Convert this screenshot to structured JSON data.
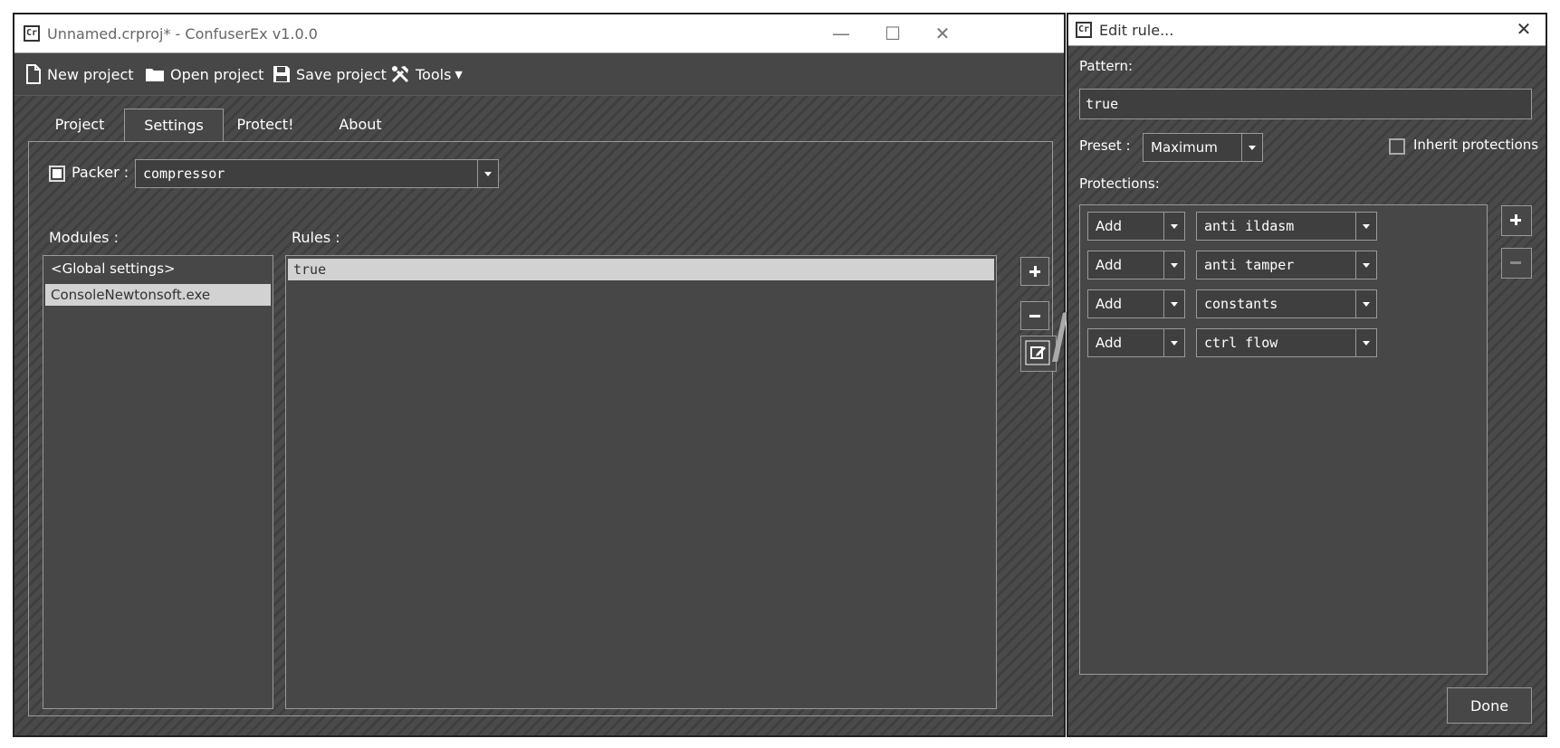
{
  "main_window": {
    "title": "Unnamed.crproj* - ConfuserEx v1.0.0",
    "app_icon": "Cr",
    "controls": {
      "minimize": "—",
      "maximize": "☐",
      "close": "✕"
    }
  },
  "toolbar": {
    "new_project": "New project",
    "open_project": "Open project",
    "save_project": "Save project",
    "tools": "Tools"
  },
  "tabs": [
    {
      "label": "Project"
    },
    {
      "label": "Settings"
    },
    {
      "label": "Protect!"
    },
    {
      "label": "About"
    }
  ],
  "settings": {
    "packer_label": "Packer :",
    "packer_value": "compressor",
    "packer_checked": true,
    "modules_label": "Modules :",
    "rules_label": "Rules :",
    "modules": [
      "<Global settings>",
      "ConsoleNewtonsoft.exe"
    ],
    "rules": [
      "true"
    ]
  },
  "dialog": {
    "title": "Edit rule...",
    "close": "✕",
    "pattern_label": "Pattern:",
    "pattern_value": "true",
    "preset_label": "Preset :",
    "preset_value": "Maximum",
    "inherit_label": "Inherit protections",
    "inherit_checked": false,
    "protections_label": "Protections:",
    "protections": [
      {
        "action": "Add",
        "name": "anti ildasm"
      },
      {
        "action": "Add",
        "name": "anti tamper"
      },
      {
        "action": "Add",
        "name": "constants"
      },
      {
        "action": "Add",
        "name": "ctrl flow"
      }
    ],
    "done_label": "Done"
  }
}
